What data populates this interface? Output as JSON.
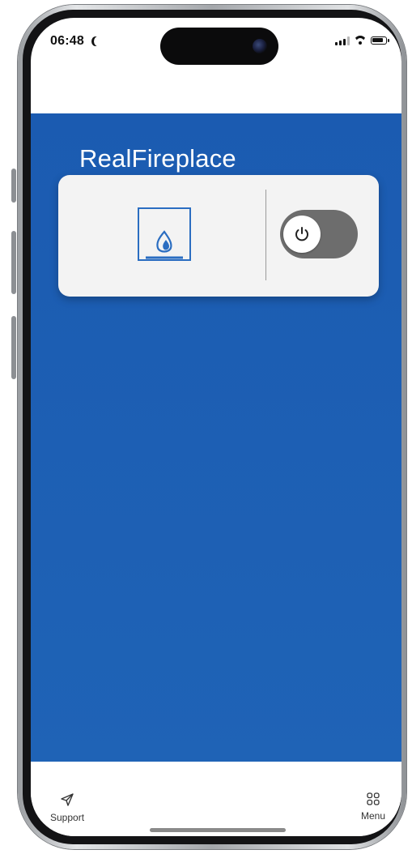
{
  "status_bar": {
    "time": "06:48",
    "icons": [
      "moon-icon",
      "signal-icon",
      "wifi-icon",
      "battery-icon"
    ]
  },
  "app": {
    "title": "RealFireplace",
    "device_card": {
      "icon": "fireplace-flame-icon",
      "power_toggle": {
        "icon": "power-icon",
        "state": "off"
      }
    }
  },
  "bottom_nav": {
    "items": [
      {
        "label": "Support",
        "icon": "send-icon"
      },
      {
        "label": "Menu",
        "icon": "grid-icon"
      }
    ]
  },
  "colors": {
    "primary_blue": "#1b5bb1",
    "card_background": "#f3f3f3",
    "toggle_off": "#6d6d6d",
    "icon_blue": "#2a6dc1"
  }
}
